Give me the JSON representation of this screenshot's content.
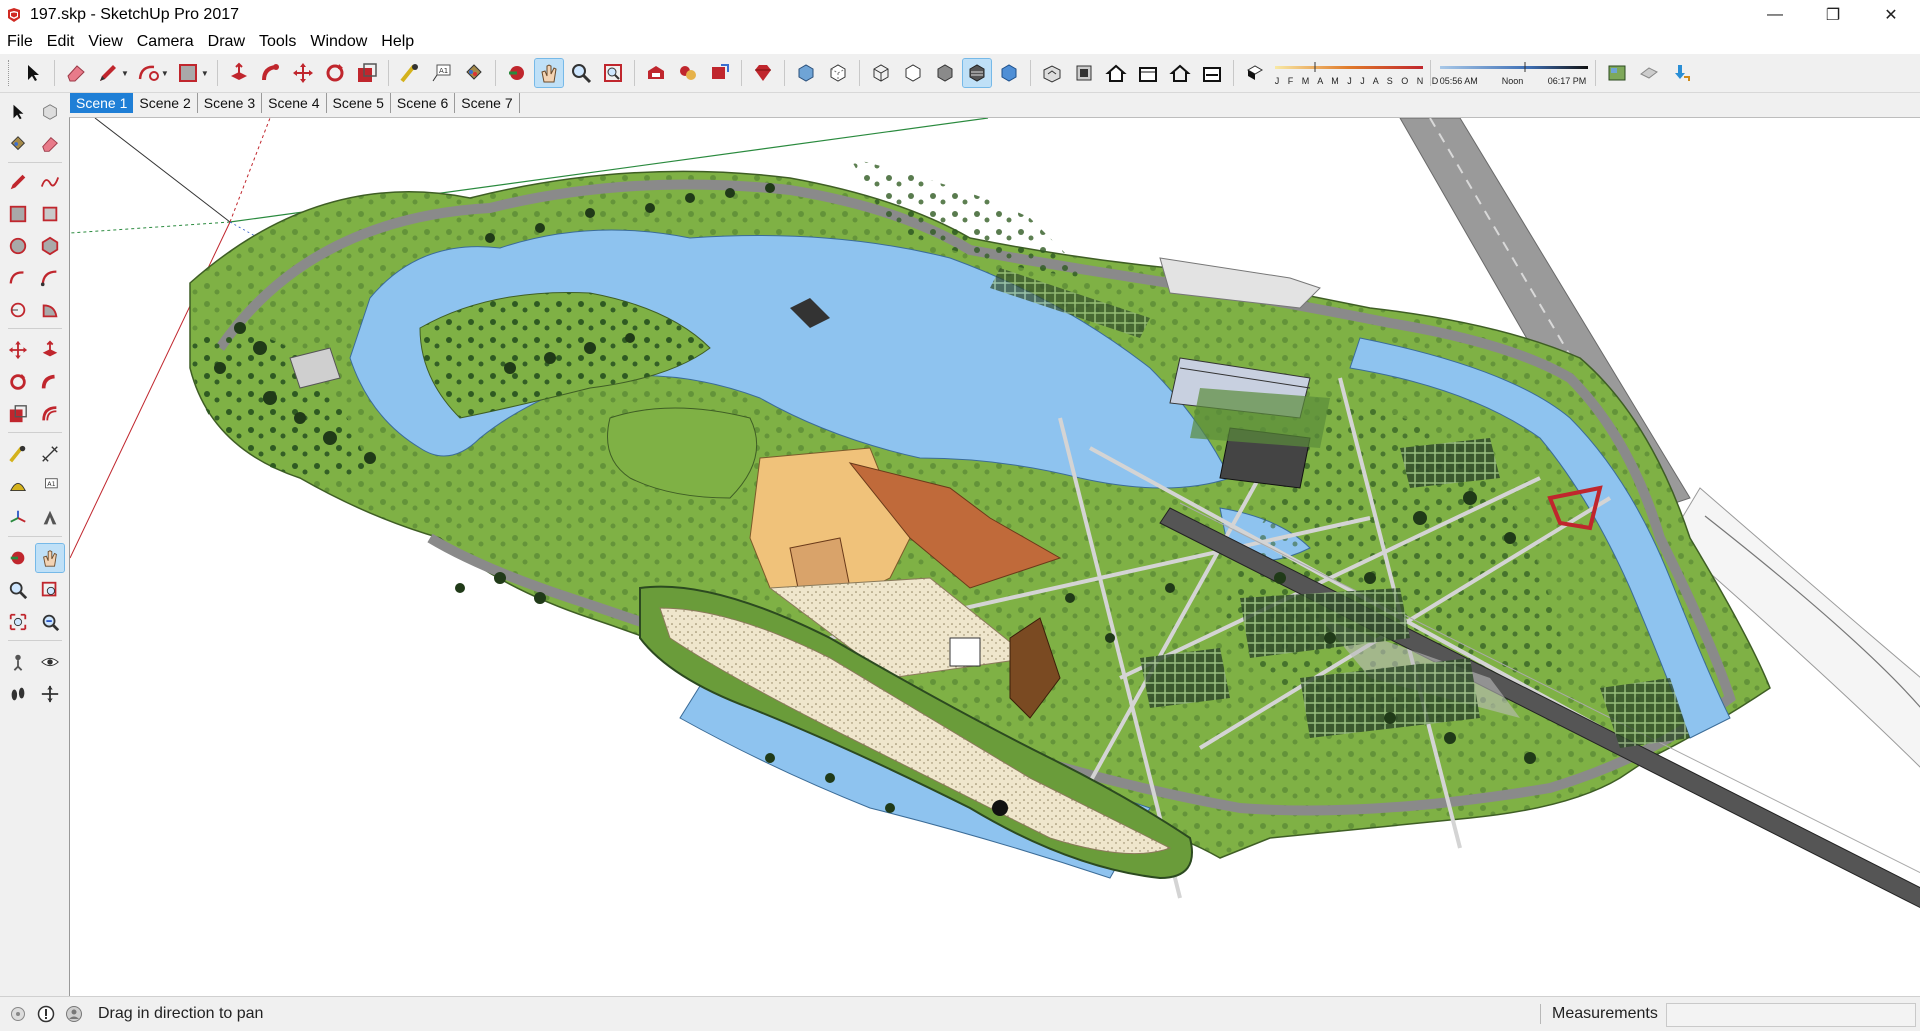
{
  "window": {
    "title": "197.skp - SketchUp Pro 2017",
    "controls": {
      "minimize": "—",
      "restore": "❐",
      "close": "✕"
    }
  },
  "menu": [
    "File",
    "Edit",
    "View",
    "Camera",
    "Draw",
    "Tools",
    "Window",
    "Help"
  ],
  "shadow_settings": {
    "months": "J F M A M J J A S O N D",
    "time_start": "05:56 AM",
    "time_mid": "Noon",
    "time_end": "06:17 PM"
  },
  "scenes": {
    "active_index": 0,
    "tabs": [
      "Scene 1",
      "Scene 2",
      "Scene 3",
      "Scene 4",
      "Scene 5",
      "Scene 6",
      "Scene 7"
    ]
  },
  "toolbar_icons": [
    "select-icon",
    "eraser-icon",
    "pencil-icon",
    "arc-icon",
    "shape-icon",
    "push-pull-icon",
    "follow-me-icon",
    "move-icon",
    "rotate-icon",
    "scale-icon",
    "tape-measure-icon",
    "text-icon",
    "paint-bucket-icon",
    "orbit-icon",
    "pan-icon",
    "zoom-icon",
    "zoom-extents-icon",
    "warehouse-icon",
    "extension-icon",
    "share-model-icon",
    "ruby-icon",
    "xray-icon",
    "back-edges-icon",
    "wireframe-icon",
    "hidden-line-icon",
    "shaded-icon",
    "shaded-textures-icon",
    "monochrome-icon",
    "iso-view-icon",
    "top-view-icon",
    "front-view-icon",
    "right-view-icon",
    "back-view-icon",
    "left-view-icon",
    "shadows-icon",
    "add-location-icon",
    "photo-texture-icon",
    "import-icon"
  ],
  "status": {
    "message": "Drag in direction to pan",
    "measurements_label": "Measurements",
    "measurements_value": ""
  },
  "colors": {
    "water": "#8ec3ef",
    "grass": "#7fb145",
    "path": "#8a8a8a",
    "tab_active": "#1f7fd6",
    "sketchup_red": "#d02a22"
  }
}
